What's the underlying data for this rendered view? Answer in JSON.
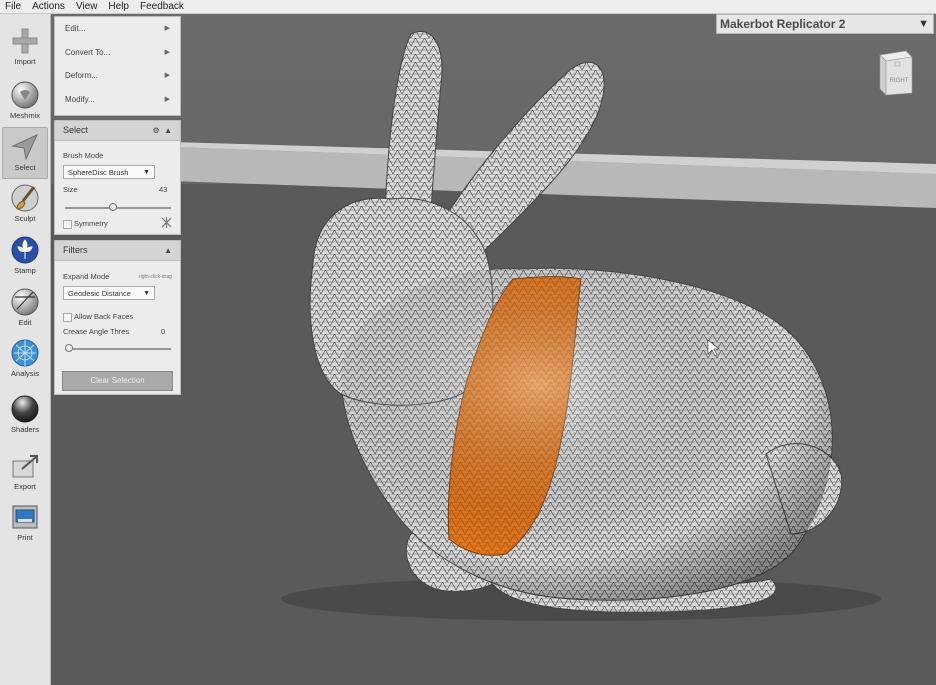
{
  "menu": [
    "File",
    "Actions",
    "View",
    "Help",
    "Feedback"
  ],
  "tools": [
    {
      "label": "Import",
      "icon": "plus-icon"
    },
    {
      "label": "Meshmix",
      "icon": "meshmix-sphere-icon"
    },
    {
      "label": "Select",
      "icon": "cursor-arrow-icon",
      "selected": true
    },
    {
      "label": "Sculpt",
      "icon": "brush-icon"
    },
    {
      "label": "Stamp",
      "icon": "fleur-stamp-icon"
    },
    {
      "label": "Edit",
      "icon": "edit-sphere-icon"
    },
    {
      "label": "Analysis",
      "icon": "analysis-sphere-icon"
    },
    {
      "label": "Shaders",
      "icon": "shader-sphere-icon"
    },
    {
      "label": "Export",
      "icon": "export-icon"
    },
    {
      "label": "Print",
      "icon": "printer-icon"
    }
  ],
  "selection_menu": [
    {
      "label": "Edit..."
    },
    {
      "label": "Convert To..."
    },
    {
      "label": "Deform..."
    },
    {
      "label": "Modify..."
    }
  ],
  "select_panel": {
    "title": "Select",
    "brush_mode_label": "Brush Mode",
    "brush_mode_value": "SphereDisc Brush",
    "size_label": "Size",
    "size_value": "43",
    "size_fraction": 0.45,
    "symmetry_label": "Symmetry"
  },
  "filters_panel": {
    "title": "Filters",
    "expand_mode_label": "Expand Mode",
    "expand_mode_hint": "right-click-drag",
    "expand_mode_value": "Geodesic Distance",
    "allow_back_faces_label": "Allow Back Faces",
    "crease_label": "Crease Angle Thres",
    "crease_value": "0",
    "crease_fraction": 0.0
  },
  "clear_selection_label": "Clear Selection",
  "printer": "Makerbot Replicator 2",
  "view_cube_label": "RIGHT",
  "colors": {
    "selection": "#e8791c",
    "mesh": "#d8d8d8",
    "floor": "#5a5a5a",
    "platform": "#b8b8b8"
  }
}
